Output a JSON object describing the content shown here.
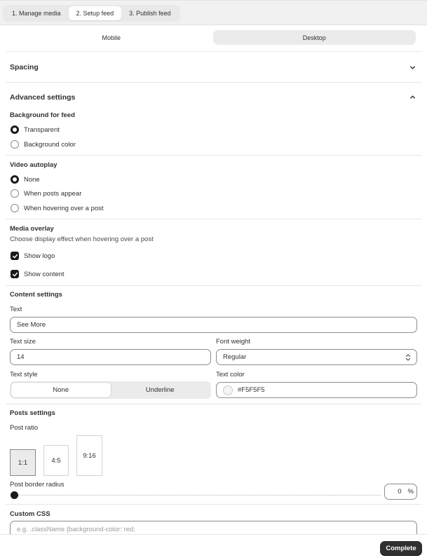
{
  "steps": [
    "1. Manage media",
    "2. Setup feed",
    "3. Publish feed"
  ],
  "active_step": 1,
  "device_tabs": [
    "Mobile",
    "Desktop"
  ],
  "active_device": 1,
  "spacing": {
    "title": "Spacing"
  },
  "advanced": {
    "title": "Advanced settings",
    "background": {
      "title": "Background for feed",
      "options": [
        "Transparent",
        "Background color"
      ],
      "selected": "Transparent"
    },
    "autoplay": {
      "title": "Video autoplay",
      "options": [
        "None",
        "When posts appear",
        "When hovering over a post"
      ],
      "selected": "None"
    },
    "overlay": {
      "title": "Media overlay",
      "help": "Choose display effect when hovering over a post",
      "show_logo": "Show logo",
      "show_content": "Show content",
      "show_logo_checked": true,
      "show_content_checked": true
    }
  },
  "content": {
    "title": "Content settings",
    "text_label": "Text",
    "text_value": "See More",
    "size_label": "Text size",
    "size_value": "14",
    "weight_label": "Font weight",
    "weight_value": "Regular",
    "style_label": "Text style",
    "style_options": [
      "None",
      "Underline"
    ],
    "style_selected": "None",
    "color_label": "Text color",
    "color_value": "#F5F5F5",
    "color_swatch": "#F5F5F5"
  },
  "posts": {
    "title": "Posts settings",
    "ratio_label": "Post ratio",
    "ratios": [
      "1:1",
      "4:5",
      "9:16"
    ],
    "ratio_selected": "1:1",
    "radius_label": "Post border radius",
    "radius_value": "0",
    "radius_unit": "%"
  },
  "css": {
    "title": "Custom CSS",
    "placeholder": "e.g. .className {background-color: red;"
  },
  "footer": {
    "complete": "Complete"
  }
}
